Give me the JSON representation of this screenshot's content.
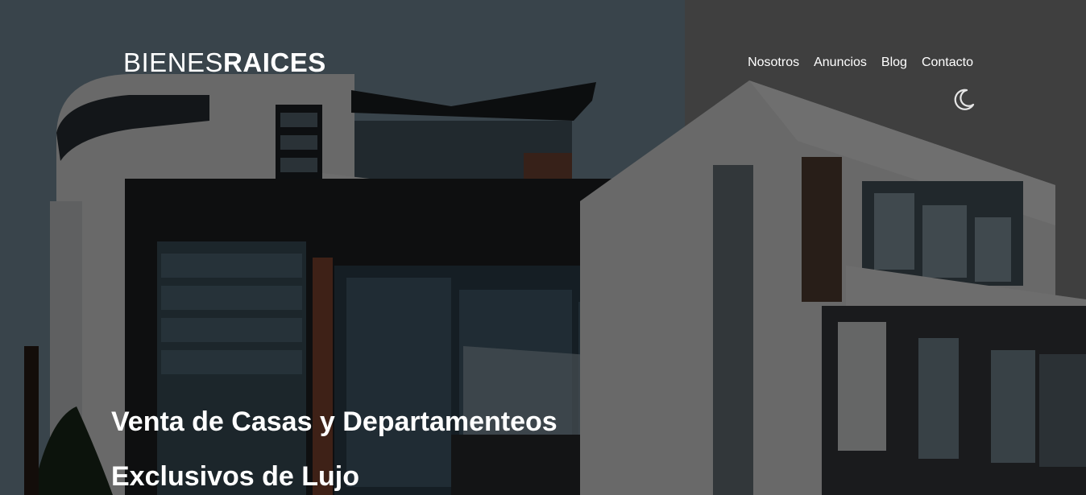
{
  "header": {
    "logo": {
      "light": "BIENES",
      "bold": "RAICES"
    },
    "nav": [
      {
        "label": "Nosotros"
      },
      {
        "label": "Anuncios"
      },
      {
        "label": "Blog"
      },
      {
        "label": "Contacto"
      }
    ],
    "theme_toggle_icon": "moon-icon"
  },
  "hero": {
    "headline_line1": "Venta de Casas y Departamenteos",
    "headline_line2": "Exclusivos de Lujo"
  },
  "colors": {
    "overlay": "rgba(0,0,0,0.55)",
    "text": "#ffffff"
  }
}
